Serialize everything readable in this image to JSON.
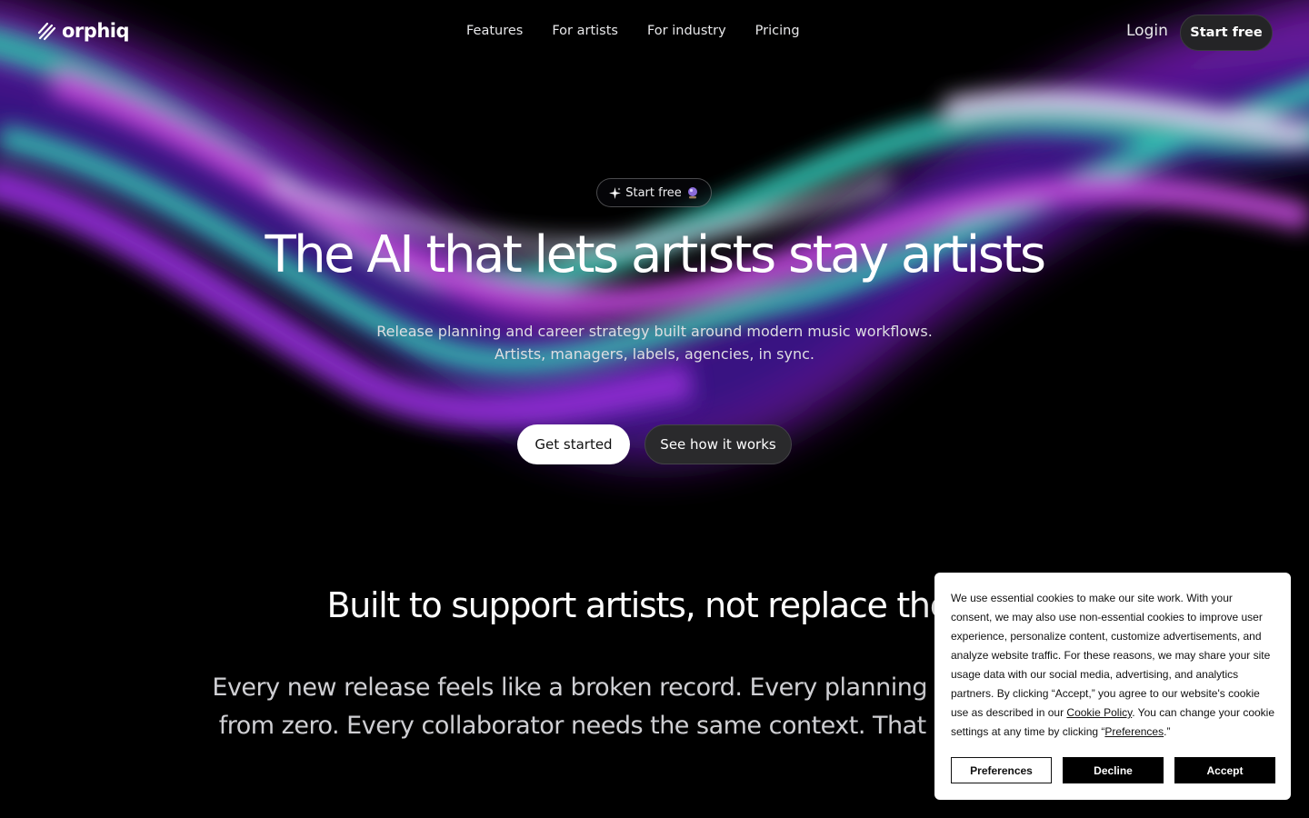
{
  "brand": {
    "name": "orphiq"
  },
  "nav": {
    "links": [
      "Features",
      "For artists",
      "For industry",
      "Pricing"
    ],
    "login": "Login",
    "cta": "Start free"
  },
  "hero": {
    "pill": "Start free",
    "title": "The AI that lets artists stay artists",
    "subtitle_line1": "Release planning and career strategy built around modern music workflows.",
    "subtitle_line2": "Artists, managers, labels, agencies, in sync.",
    "primary_button": "Get started",
    "secondary_button": "See how it works"
  },
  "section": {
    "title": "Built to support artists, not replace them",
    "body": "Every new release feels like a broken record. Every planning session starts from zero. Every collaborator needs the same context.  That world is over."
  },
  "cookie_banner": {
    "text_part1": "We use essential cookies to make our site work. With your consent, we may also use non-essential cookies to improve user experience, personalize content, customize advertisements, and analyze website traffic. For these reasons, we may share your site usage data with our social media, advertising, and analytics partners. By clicking “Accept,” you agree to our website's cookie use as described in our ",
    "policy_link": "Cookie Policy",
    "text_part2": ". You can change your cookie settings at any time by clicking “",
    "preferences_link": "Preferences",
    "text_part3": ".”",
    "buttons": {
      "preferences": "Preferences",
      "decline": "Decline",
      "accept": "Accept"
    }
  },
  "icons": {
    "logo": "orphiq-logo-icon",
    "pill_left": "sparkle-icon",
    "pill_right": "crystal-ball-icon"
  },
  "colors": {
    "background": "#000000",
    "primary_button_bg": "#ffffff",
    "secondary_button_bg": "#2a2a2c",
    "cookie_bg": "#ffffff",
    "cookie_solid_button": "#000000"
  }
}
